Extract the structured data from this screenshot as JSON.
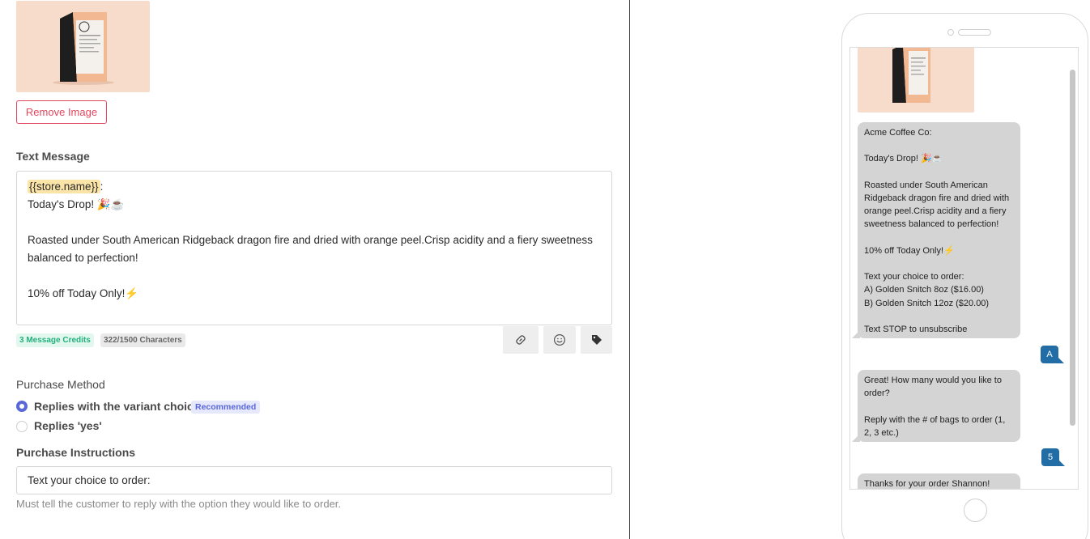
{
  "image_block": {
    "remove_label": "Remove Image"
  },
  "text_message": {
    "label": "Text Message",
    "store_var": "{{store.name}}",
    "after_var": ":",
    "body": "\nToday's Drop! 🎉☕\n\nRoasted under South American Ridgeback dragon fire and dried with orange peel.Crisp acidity and a fiery sweetness balanced to perfection!\n\n10% off Today Only!⚡",
    "credits": "3 Message Credits",
    "characters": "322/1500 Characters",
    "tools": [
      "link-icon",
      "emoji-icon",
      "tag-icon"
    ]
  },
  "purchase_method": {
    "label": "Purchase Method",
    "options": [
      {
        "label": "Replies with the variant choice",
        "badge": "Recommended",
        "selected": true
      },
      {
        "label": "Replies 'yes'",
        "selected": false
      }
    ]
  },
  "purchase_instructions": {
    "label": "Purchase Instructions",
    "value": "Text your choice to order:",
    "help": "Must tell the customer to reply with the option they would like to order."
  },
  "preview": {
    "messages": [
      {
        "from": "store",
        "text": "Acme Coffee Co:\n\nToday's Drop! 🎉☕\n\nRoasted under South American Ridgeback dragon fire and dried with orange peel.Crisp acidity and a fiery sweetness balanced to perfection!\n\n10% off Today Only!⚡\n\nText your choice to order:\nA) Golden Snitch 8oz ($16.00)\nB) Golden Snitch 12oz ($20.00)\n\nText STOP to unsubscribe"
      },
      {
        "from": "customer",
        "text": "A"
      },
      {
        "from": "store",
        "text": "Great! How many would you like to order?\n\nReply with the # of bags to order (1, 2, 3 etc.)"
      },
      {
        "from": "customer",
        "text": "5"
      },
      {
        "from": "store",
        "text": "Thanks for your order Shannon!"
      }
    ]
  },
  "colors": {
    "danger": "#e0475f",
    "accent": "#5a67d8",
    "success": "#23b07d",
    "reply_bubble": "#236da6",
    "store_bubble": "#d4d4d4",
    "product_bg": "#f8dccb"
  }
}
